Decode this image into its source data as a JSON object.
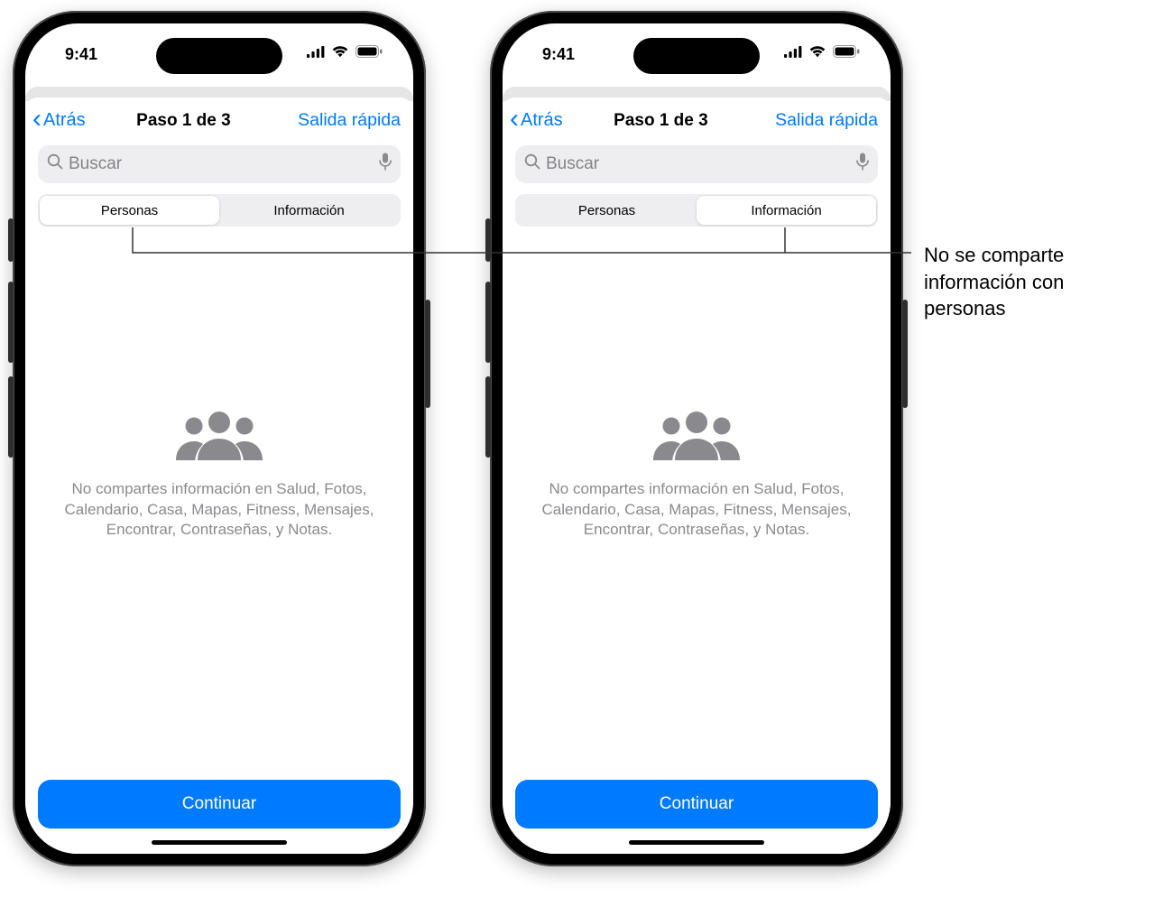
{
  "status": {
    "time": "9:41"
  },
  "nav": {
    "back": "Atrás",
    "title": "Paso 1 de 3",
    "quick_exit": "Salida rápida"
  },
  "search": {
    "placeholder": "Buscar"
  },
  "tabs": {
    "personas": "Personas",
    "informacion": "Información"
  },
  "empty": {
    "message": "No compartes información en Salud, Fotos, Calendario, Casa, Mapas, Fitness, Mensajes, Encontrar, Contraseñas, y Notas."
  },
  "continue": "Continuar",
  "callout": "No se comparte información con personas",
  "phones": {
    "left": {
      "active_tab": "personas"
    },
    "right": {
      "active_tab": "informacion"
    }
  }
}
